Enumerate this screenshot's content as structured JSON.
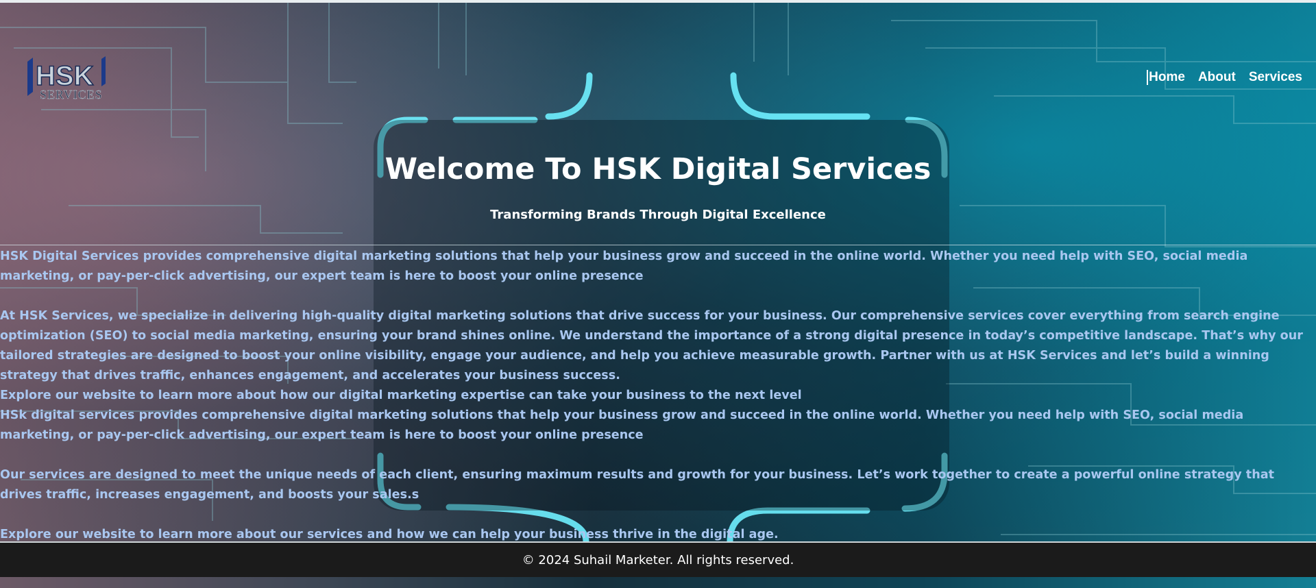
{
  "header": {
    "logo_text_main": "HSK",
    "logo_text_sub": "SERVICES"
  },
  "nav": {
    "items": [
      "Home",
      "About",
      "Services"
    ]
  },
  "hero": {
    "title": "Welcome To HSK Digital Services",
    "subtitle": "Transforming Brands Through Digital Excellence"
  },
  "content": {
    "p1": "HSK Digital Services provides comprehensive digital marketing solutions that help your business grow and succeed in the online world. Whether you need help with SEO, social media marketing, or pay-per-click advertising, our expert team is here to boost your online presence",
    "p2": "At HSK Services, we specialize in delivering high-quality digital marketing solutions that drive success for your business. Our comprehensive services cover everything from search engine optimization (SEO) to social media marketing, ensuring your brand shines online. We understand the importance of a strong digital presence in today’s competitive landscape. That’s why our tailored strategies are designed to boost your online visibility, engage your audience, and help you achieve measurable growth. Partner with us at HSK Services and let’s build a winning strategy that drives traffic, enhances engagement, and accelerates your business success.",
    "p3": "Explore our website to learn more about how our digital marketing expertise can take your business to the next level",
    "p4": "HSk digital services provides comprehensive digital marketing solutions that help your business grow and succeed in the online world. Whether you need help with SEO, social media marketing, or pay-per-click advertising, our expert team is here to boost your online presence",
    "p5": "Our services are designed to meet the unique needs of each client, ensuring maximum results and growth for your business. Let’s work together to create a powerful online strategy that drives traffic, increases engagement, and boosts your sales.s",
    "p6": "Explore our website to learn more about our services and how we can help your business thrive in the digital age."
  },
  "footer": {
    "copyright": "© 2024 Suhail Marketer. All rights reserved."
  },
  "colors": {
    "content_text": "#a9c7f0",
    "footer_bg": "#1b1b1b",
    "circuit_glow": "#6ff0ff"
  }
}
